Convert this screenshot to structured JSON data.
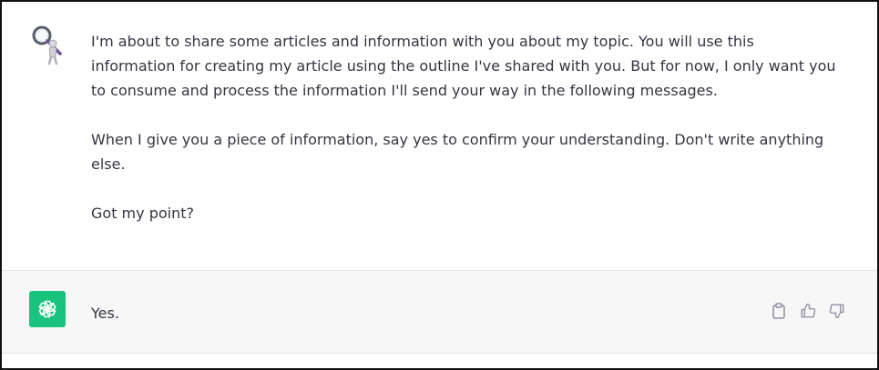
{
  "conversation": {
    "user_message": {
      "avatar_icon": "magnifier-figure-avatar-icon",
      "paragraphs": [
        "I'm about to share some articles and information with you about my topic. You will use this information for creating my article using the outline I've shared with you. But for now, I only want you to consume and process the information I'll send your way in the following messages.",
        "When I give you a piece of information, say yes to confirm your understanding. Don't write anything else.",
        "Got my point?"
      ]
    },
    "assistant_message": {
      "avatar_icon": "openai-logo-icon",
      "avatar_color": "#19c37d",
      "text": "Yes.",
      "actions": [
        "copy-icon",
        "thumbs-up-icon",
        "thumbs-down-icon"
      ]
    }
  }
}
